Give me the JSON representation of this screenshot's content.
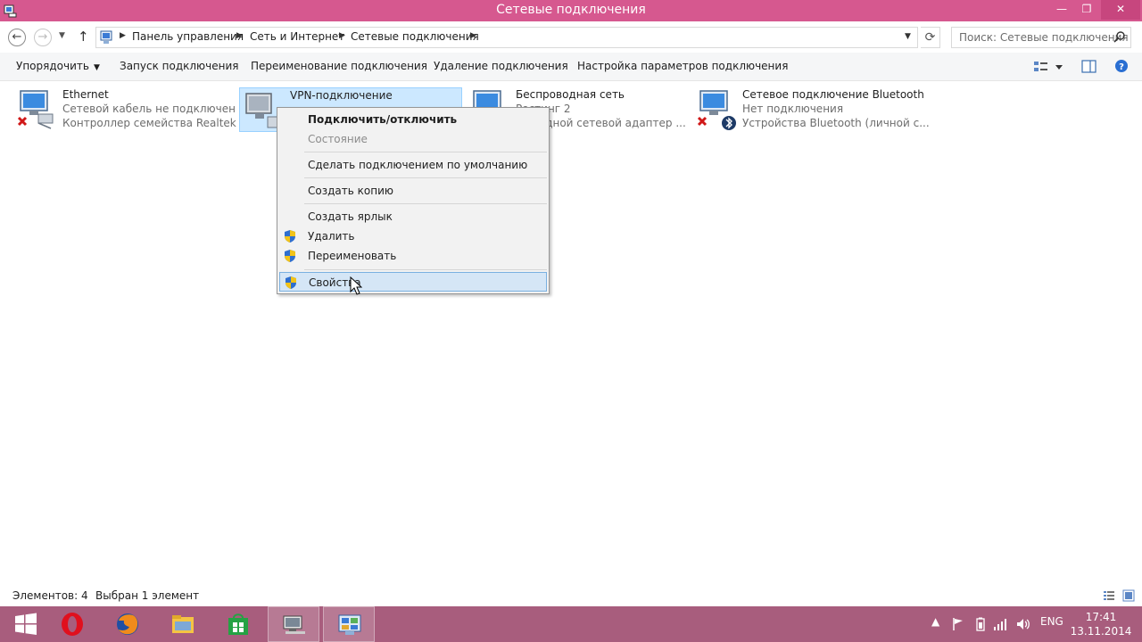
{
  "window": {
    "title": "Сетевые подключения",
    "minimize": "—",
    "maximize": "❐",
    "close": "✕"
  },
  "address": {
    "breadcrumbs": [
      "Панель управления",
      "Сеть и Интернет",
      "Сетевые подключения"
    ],
    "search_placeholder": "Поиск: Сетевые подключения"
  },
  "commands": {
    "organize": "Упорядочить",
    "start": "Запуск подключения",
    "rename": "Переименование подключения",
    "delete": "Удаление подключения",
    "settings": "Настройка параметров подключения"
  },
  "connections": [
    {
      "name": "Ethernet",
      "status": "Сетевой кабель не подключен",
      "device": "Контроллер семейства Realtek P..."
    },
    {
      "name": "VPN-подключение",
      "status": "",
      "device": ""
    },
    {
      "name": "Беспроводная сеть",
      "status": "Ростинг 2",
      "device": "...оводной сетевой адаптер ..."
    },
    {
      "name": "Сетевое подключение Bluetooth",
      "status": "Нет подключения",
      "device": "Устройства Bluetooth (личной с..."
    }
  ],
  "context_menu": {
    "connect": "Подключить/отключить",
    "status": "Состояние",
    "set_default": "Сделать подключением по умолчанию",
    "copy": "Создать копию",
    "shortcut": "Создать ярлык",
    "delete": "Удалить",
    "rename": "Переименовать",
    "properties": "Свойства"
  },
  "statusbar": {
    "items": "Элементов: 4",
    "selected": "Выбран 1 элемент"
  },
  "tray": {
    "lang": "ENG",
    "time": "17:41",
    "date": "13.11.2014"
  },
  "colors": {
    "titlebar": "#d6588f",
    "taskbar": "#a85d7d",
    "selection": "#cce8ff"
  }
}
